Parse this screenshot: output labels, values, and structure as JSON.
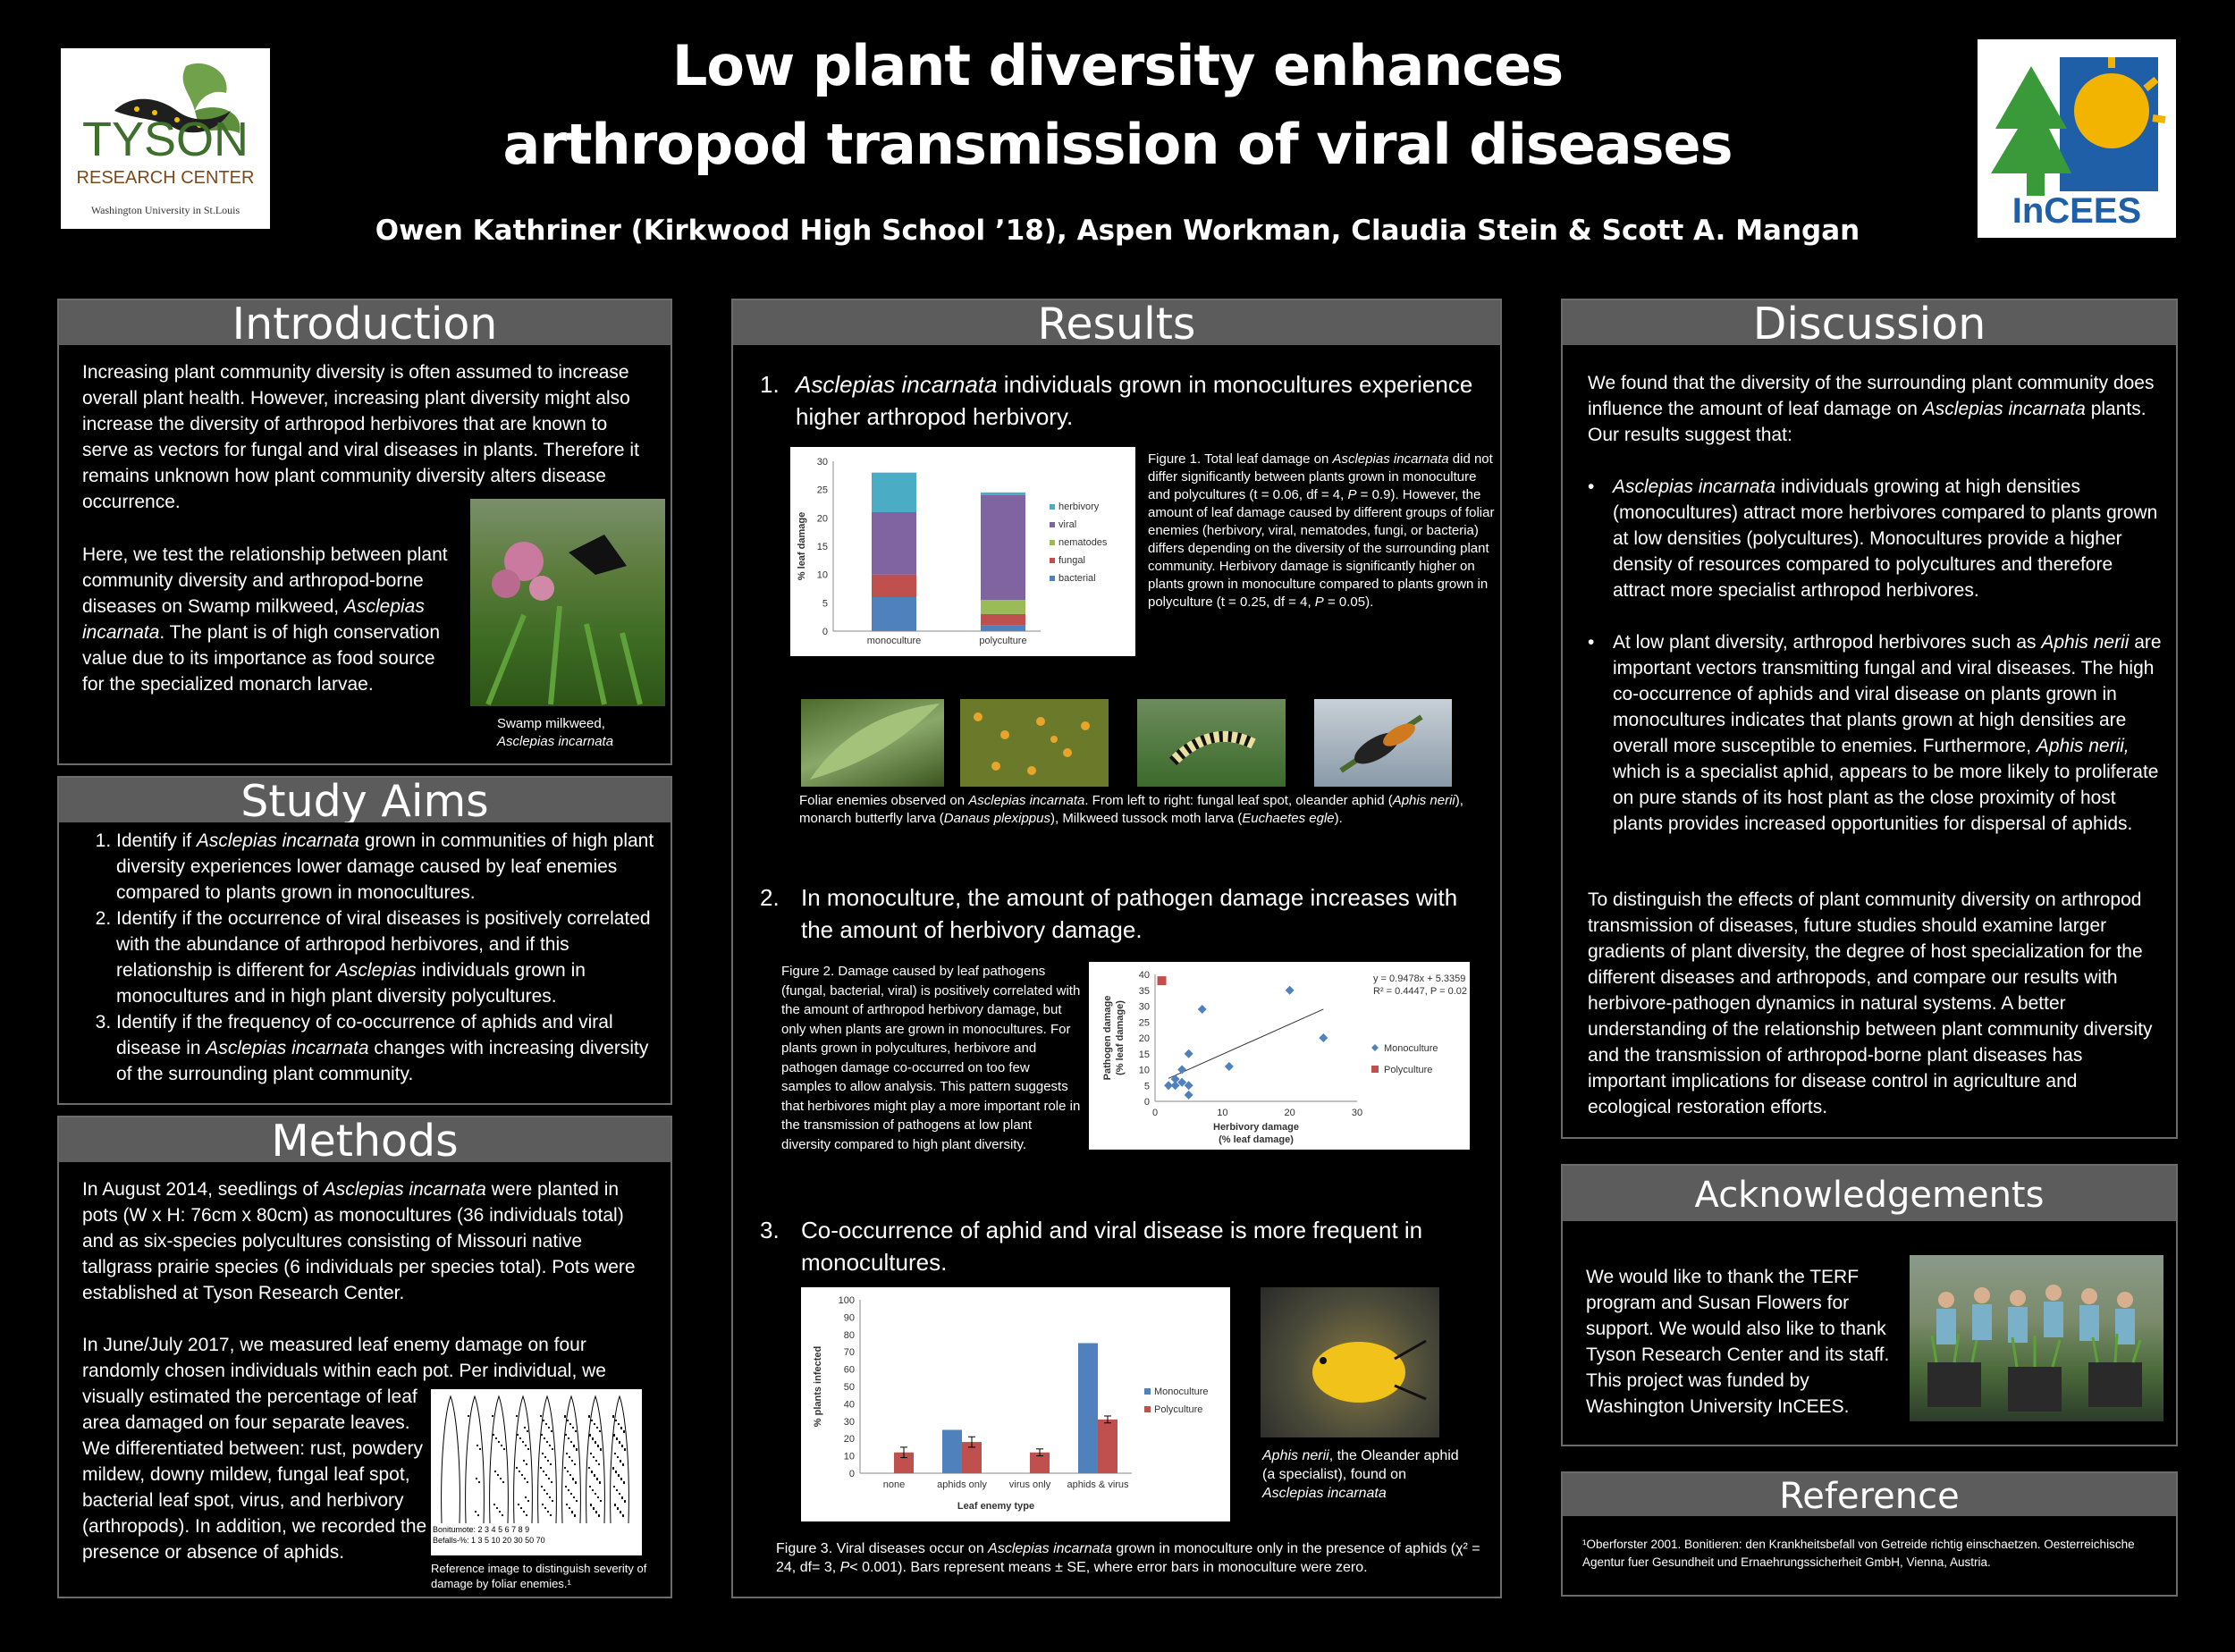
{
  "header": {
    "title_line1": "Low plant diversity enhances",
    "title_line2": "arthropod transmission of viral diseases",
    "authors": "Owen Kathriner (Kirkwood High School ’18), Aspen Workman, Claudia Stein & Scott A. Mangan",
    "logo_left": {
      "line1": "TYSON",
      "line2": "RESEARCH CENTER",
      "line3": "Washington University in St.Louis"
    },
    "logo_right": {
      "text": "InCEES"
    }
  },
  "introduction": {
    "heading": "Introduction",
    "p1": "Increasing plant community diversity is often assumed to increase  overall plant health. However, increasing plant diversity might also increase the diversity of arthropod herbivores that are known to serve as vectors for fungal and viral diseases in plants. Therefore it remains unknown how plant community diversity alters disease occurrence.",
    "p2a": "Here, we test the relationship between plant community diversity and arthropod-borne diseases on Swamp milkweed,",
    "p2b": "Asclepias incarnata",
    "p2c": ". The plant is of high conservation value due to its importance as food source for the specialized monarch larvae.",
    "photo_caption_1": "Swamp milkweed,",
    "photo_caption_2": "Asclepias incarnata"
  },
  "study_aims": {
    "heading": "Study Aims",
    "a1_pre": "Identify if ",
    "a1_it": "Asclepias incarnata",
    "a1_post": " grown in communities of high plant diversity experiences lower damage caused by leaf enemies compared to plants grown in monocultures.",
    "a2_pre": "Identify if the occurrence of viral diseases is positively correlated with the abundance of arthropod herbivores, and if this relationship is different for ",
    "a2_it": "Asclepias",
    "a2_post": " individuals grown in monocultures and in high plant diversity polycultures.",
    "a3_pre": "Identify if the frequency of co-occurrence of aphids and viral disease in ",
    "a3_it": "Asclepias incarnata",
    "a3_post": " changes with increasing diversity of the surrounding plant community."
  },
  "methods": {
    "heading": "Methods",
    "p1_pre": "In August 2014, seedlings of ",
    "p1_it": "Asclepias incarnata",
    "p1_post": " were planted  in pots (W x H: 76cm x 80cm) as monocultures (36 individuals total) and as six-species polycultures consisting of Missouri native tallgrass prairie species (6 individuals per species total). Pots were established at Tyson Research Center.",
    "p2_top": "In June/July 2017, we measured  leaf enemy damage on four randomly chosen individuals within each  pot. Per individual, we",
    "p2_side": "visually estimated the percentage of leaf area damaged on four separate leaves. We differentiated between: rust, powdery mildew, downy mildew, fungal leaf spot, bacterial leaf spot, virus, and herbivory (arthropods). In addition, we recorded the presence or absence of aphids.",
    "ref_caption": "Reference image to distinguish severity of damage by foliar enemies.¹",
    "scale_row1_label": "Bonitumote:",
    "scale_row1": [
      "2",
      "3",
      "4",
      "5",
      "6",
      "7",
      "8",
      "9"
    ],
    "scale_row2_label": "Befalls-%:",
    "scale_row2": [
      "1",
      "3",
      "5",
      "10",
      "20",
      "30",
      "50",
      "70"
    ]
  },
  "results": {
    "heading": "Results",
    "h1_num": "1.",
    "h1_it": "Asclepias incarnata",
    "h1_post": " individuals grown in monocultures experience higher arthropod herbivory.",
    "fig1_caption_a": "Figure 1. Total leaf damage on ",
    "fig1_caption_it": "Asclepias incarnata",
    "fig1_caption_b": " did not differ significantly between plants grown in monoculture and polycultures (t = 0.06, df = 4, ",
    "fig1_P1": "P",
    "fig1_caption_c": " = 0.9). However, the amount of leaf damage caused by different groups of foliar enemies  (herbivory, viral, nematodes, fungi, or bacteria)  differs depending on the diversity of the surrounding plant community. Herbivory damage is significantly higher on plants grown in monoculture compared to plants grown in polyculture (t = 0.25, df = 4, ",
    "fig1_P2": "P",
    "fig1_caption_d": " = 0.05).",
    "foliar_caption_a": "Foliar enemies observed on ",
    "foliar_caption_it1": "Asclepias incarnata",
    "foliar_caption_b": ". From left to right: fungal leaf spot, oleander aphid (",
    "foliar_caption_it2": "Aphis nerii",
    "foliar_caption_c": "), monarch butterfly larva (",
    "foliar_caption_it3": "Danaus plexippus",
    "foliar_caption_d": "), Milkweed tussock moth larva (",
    "foliar_caption_it4": "Euchaetes egle",
    "foliar_caption_e": ").",
    "h2_num": "2.",
    "h2_text": "In monoculture, the amount of pathogen damage increases with the amount of herbivory damage.",
    "fig2_caption": "Figure 2. Damage caused by leaf pathogens (fungal, bacterial, viral) is positively correlated with the amount of arthropod herbivory damage, but only  when  plants are grown in monocultures. For plants grown in polycultures, herbivore and pathogen damage co-occurred on too few samples to allow analysis. This pattern suggests that herbivores might play a more important role in the transmission of pathogens at low plant diversity compared to high plant diversity.",
    "h3_num": "3.",
    "h3_text": "Co-occurrence of aphid and viral disease is more frequent in monocultures.",
    "aphid_caption_it1": "Aphis nerii",
    "aphid_caption_a": ", the Oleander aphid (a specialist), found on ",
    "aphid_caption_it2": "Asclepias incarnata",
    "fig3_caption_a": "Figure 3. Viral diseases  occur on ",
    "fig3_caption_it": "Asclepias incarnata",
    "fig3_caption_b": " grown in monoculture  only in the presence of aphids (χ² = 24, df= 3, ",
    "fig3_P": "P",
    "fig3_caption_c": "< 0.001). Bars represent means  ± SE, where error bars in monoculture were zero."
  },
  "discussion": {
    "heading": "Discussion",
    "p1_a": "We found that the diversity of the surrounding plant community does influence the amount of leaf damage on ",
    "p1_it": "Asclepias incarnata",
    "p1_b": " plants. Our results suggest that:",
    "b1_it": "Asclepias incarnata",
    "b1_text": " individuals growing at high densities (monocultures) attract more herbivores compared to plants grown at low densities (polycultures). Monocultures provide a higher density of resources compared to polycultures and therefore attract more specialist arthropod herbivores.",
    "b2_a": "At low plant diversity, arthropod herbivores such as ",
    "b2_it1": "Aphis nerii",
    "b2_b": " are important vectors transmitting fungal and viral diseases. The high co-occurrence of aphids and viral disease on plants grown in monocultures indicates that plants grown at high densities are overall more susceptible to enemies. Furthermore, ",
    "b2_it2": "Aphis nerii,",
    "b2_c": " which is a specialist aphid, appears to be more likely to proliferate on pure stands of its host plant as the close proximity of host plants provides increased opportunities for dispersal of aphids.",
    "p2": "To distinguish the effects of plant community diversity on arthropod transmission of diseases, future studies should examine larger gradients of plant diversity, the degree of host specialization for the different diseases and arthropods, and compare our results with herbivore-pathogen dynamics in natural systems.  A better understanding of the relationship between plant community diversity and the transmission of arthropod-borne plant diseases has important implications for disease control in agriculture and ecological restoration efforts."
  },
  "acknowledgements": {
    "heading": "Acknowledgements",
    "text": "We would like to thank the TERF program and Susan Flowers for support.  We would also like to thank Tyson Research Center and its staff. This project was funded by Washington University InCEES."
  },
  "reference": {
    "heading": "Reference",
    "text": "¹Oberforster 2001. Bonitieren: den Krankheitsbefall von Getreide richtig einschaetzen. Oesterreichische Agentur fuer Gesundheit und  Ernaehrungssicherheit GmbH, Vienna, Austria."
  },
  "chart_data": [
    {
      "type": "bar",
      "stacked": true,
      "categories": [
        "monoculture",
        "polyculture"
      ],
      "ylabel": "% leaf damage",
      "ylim": [
        0,
        30
      ],
      "yticks": [
        0,
        5,
        10,
        15,
        20,
        25,
        30
      ],
      "series": [
        {
          "name": "bacterial",
          "color": "#4f81bd",
          "values": [
            6,
            1
          ]
        },
        {
          "name": "fungal",
          "color": "#c0504d",
          "values": [
            4,
            2
          ]
        },
        {
          "name": "nematodes",
          "color": "#9bbb59",
          "values": [
            0,
            2.5
          ]
        },
        {
          "name": "viral",
          "color": "#8064a2",
          "values": [
            11,
            18.5
          ]
        },
        {
          "name": "herbivory",
          "color": "#4bacc6",
          "values": [
            7,
            0.5
          ]
        }
      ],
      "legend_order": [
        "herbivory",
        "viral",
        "nematodes",
        "fungal",
        "bacterial"
      ],
      "legend": "right"
    },
    {
      "type": "scatter",
      "xlabel_line1": "Herbivory damage",
      "xlabel_line2": "(% leaf damage)",
      "ylabel_line1": "Pathogen damage",
      "ylabel_line2": "(% leaf damage)",
      "xlim": [
        0,
        30
      ],
      "ylim": [
        0,
        40
      ],
      "xticks": [
        0,
        10,
        20,
        30
      ],
      "yticks": [
        0,
        5,
        10,
        15,
        20,
        25,
        30,
        35,
        40
      ],
      "series": [
        {
          "name": "Monoculture",
          "color": "#4f81bd",
          "marker": "diamond",
          "x": [
            2,
            3,
            3,
            4,
            4,
            5,
            5,
            5,
            7,
            11,
            20,
            25
          ],
          "y": [
            5,
            5,
            7,
            6,
            10,
            2,
            5,
            15,
            29,
            11,
            35,
            20
          ]
        },
        {
          "name": "Polyculture",
          "color": "#c0504d",
          "marker": "square",
          "x": [
            1
          ],
          "y": [
            38
          ]
        }
      ],
      "trendline": {
        "x0": 2,
        "x1": 25,
        "slope": 0.9478,
        "intercept": 5.3359
      },
      "equation": "y = 0.9478x + 5.3359",
      "r2": "R² = 0.4447, P = 0.02",
      "legend": "right"
    },
    {
      "type": "bar",
      "categories": [
        "none",
        "aphids only",
        "virus only",
        "aphids & virus"
      ],
      "xlabel": "Leaf enemy type",
      "ylabel": "% plants infected",
      "ylim": [
        0,
        100
      ],
      "yticks": [
        0,
        10,
        20,
        30,
        40,
        50,
        60,
        70,
        80,
        90,
        100
      ],
      "series": [
        {
          "name": "Monoculture",
          "color": "#4f81bd",
          "values": [
            0,
            25,
            0,
            75
          ],
          "errors": [
            0,
            0,
            0,
            0
          ]
        },
        {
          "name": "Polyculture",
          "color": "#c0504d",
          "values": [
            12,
            18,
            12,
            31
          ],
          "errors": [
            3,
            3,
            2,
            2
          ]
        }
      ],
      "legend": "right"
    }
  ]
}
